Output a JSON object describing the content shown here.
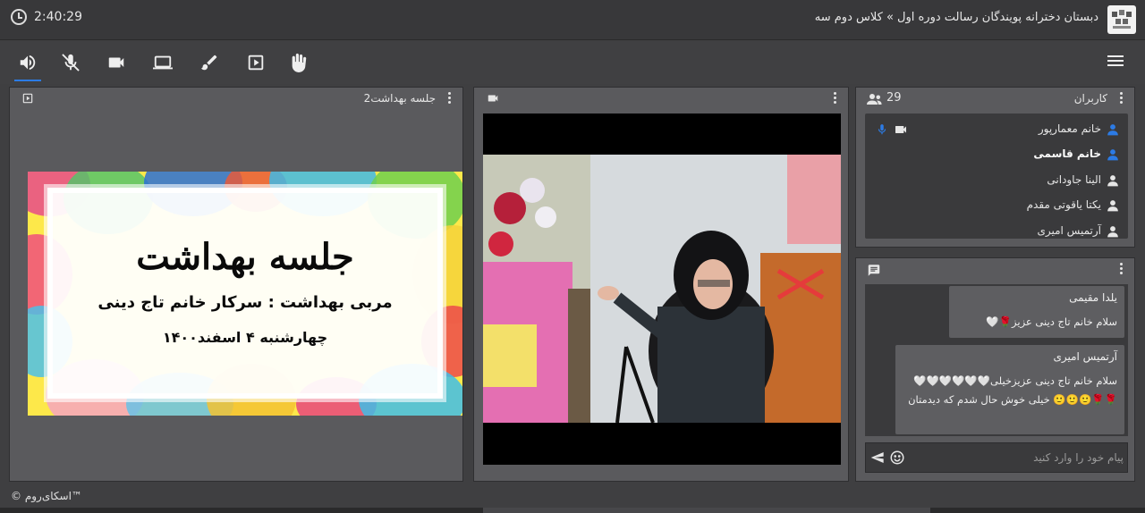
{
  "topbar": {
    "timer": "2:40:29",
    "room_title": "دبستان دخترانه پویندگان رسالت دوره اول » کلاس دوم سه"
  },
  "toolbar": {
    "tools": [
      "speaker-icon",
      "mic-muted-icon",
      "camera-icon",
      "screen-share-icon",
      "brush-icon",
      "play-icon",
      "raise-hand-icon"
    ]
  },
  "presentation": {
    "title": "جلسه بهداشت2",
    "slide": {
      "heading": "جلسه بهداشت",
      "subtitle": "مربی بهداشت : سرکار خانم تاج دینی",
      "date": "چهارشنبه ۴ اسفند۱۴۰۰"
    }
  },
  "users": {
    "title": "کاربران",
    "count": "29",
    "items": [
      {
        "name": "خانم معمارپور",
        "highlight": true,
        "bold": false
      },
      {
        "name": "خانم قاسمی",
        "highlight": true,
        "bold": true
      },
      {
        "name": "الینا جاودانی",
        "highlight": false,
        "bold": false
      },
      {
        "name": "یکتا یاقوتی مقدم",
        "highlight": false,
        "bold": false
      },
      {
        "name": "آرتمیس امیری",
        "highlight": false,
        "bold": false
      }
    ]
  },
  "chat": {
    "messages": [
      {
        "sender": "یلدا مقیمی",
        "lines": [
          "سلام خانم تاج دینی عزیز🌹🤍"
        ]
      },
      {
        "sender": "آرتمیس امیری",
        "lines": [
          "سلام خانم تاج دینی عزیزخیلی🤍🤍🤍🤍🤍🤍",
          "🌹🌹🙂🙂🙂 خیلی خوش حال شدم که دیدمتان"
        ]
      }
    ],
    "input_placeholder": "پیام خود را وارد کنید"
  },
  "footer": {
    "brand": "© اسکای‌روم™"
  },
  "colors": {
    "accent": "#2c7be5",
    "background": "#3f3f41",
    "panel": "#5a5a5d"
  }
}
